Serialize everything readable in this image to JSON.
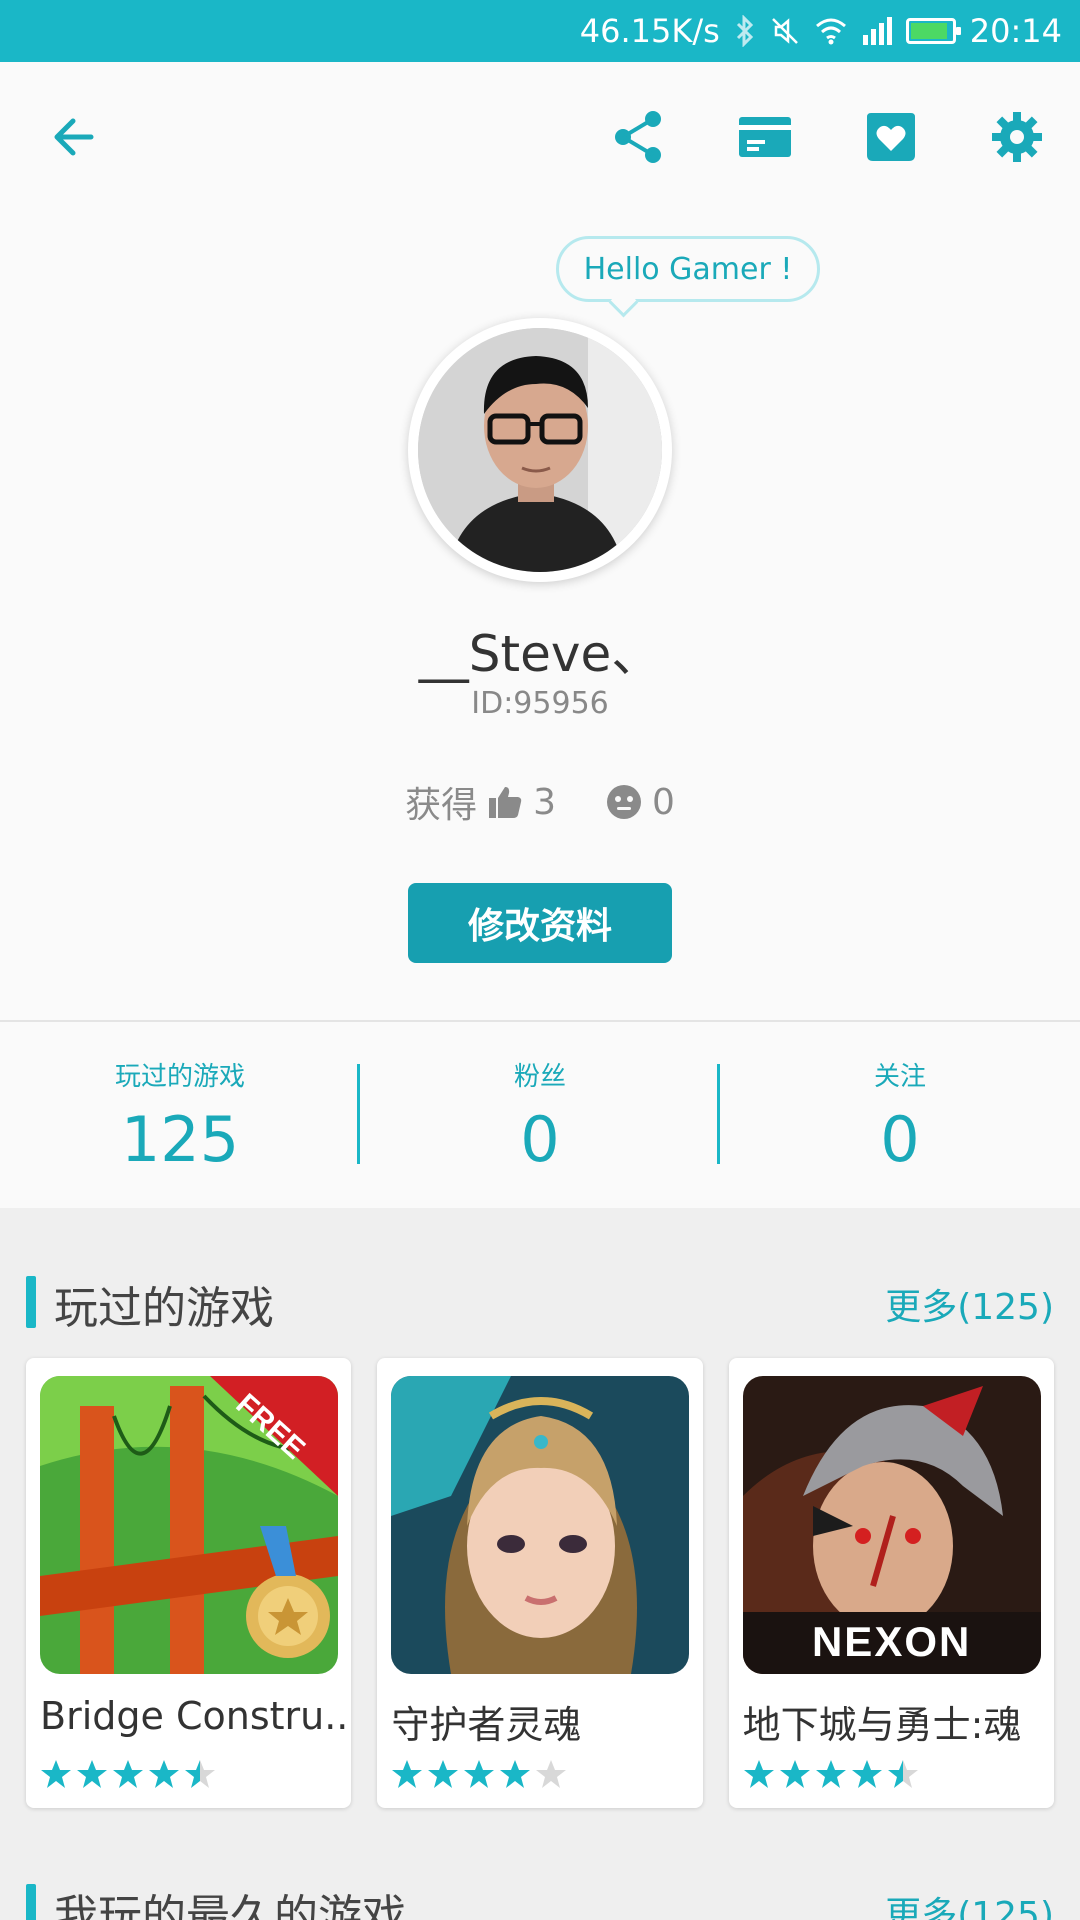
{
  "status_bar": {
    "speed": "46.15K/s",
    "time": "20:14",
    "battery_level": 0.9
  },
  "toolbar": {
    "back_icon": "arrow-left-icon",
    "share_icon": "share-icon",
    "card_icon": "card-icon",
    "favorite_icon": "heart-box-icon",
    "settings_icon": "gear-icon"
  },
  "profile": {
    "greeting": "Hello Gamer !",
    "username": "__Steve、",
    "id": "ID:95956",
    "earned_label": "获得",
    "likes": "3",
    "dislikes": "0",
    "edit_button": "修改资料"
  },
  "stats": [
    {
      "label": "玩过的游戏",
      "value": "125"
    },
    {
      "label": "粉丝",
      "value": "0"
    },
    {
      "label": "关注",
      "value": "0"
    }
  ],
  "played_section": {
    "title": "玩过的游戏",
    "more": "更多(125)",
    "games": [
      {
        "name": "Bridge Constru...",
        "rating": 4.5,
        "badge": "FREE"
      },
      {
        "name": "守护者灵魂",
        "rating": 4
      },
      {
        "name": "地下城与勇士:魂",
        "rating": 4.5,
        "badge": "NEXON"
      }
    ]
  },
  "longest_section": {
    "title": "我玩的最久的游戏",
    "more": "更多(125)"
  },
  "colors": {
    "accent": "#1ab7c7",
    "button": "#179fb0",
    "star": "#1ab7c7"
  }
}
